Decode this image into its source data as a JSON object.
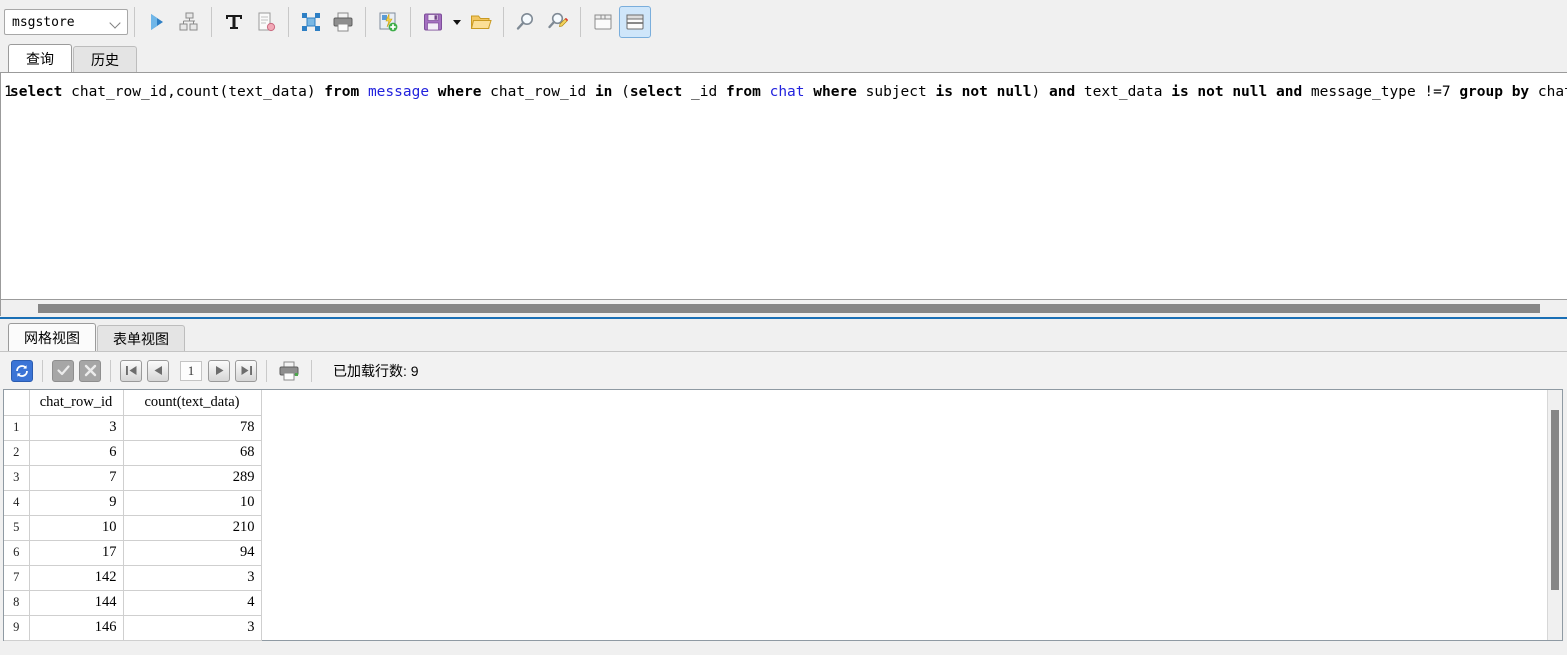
{
  "toolbar": {
    "database_select": {
      "value": "msgstore",
      "icon": "chevron-down-icon"
    },
    "buttons": [
      {
        "name": "execute-query-button",
        "icon": "play-icon",
        "title": "执行"
      },
      {
        "name": "explain-query-button",
        "icon": "hierarchy-icon",
        "title": "执行计划"
      },
      {
        "name": "format-text-button",
        "icon": "text-T-icon",
        "title": "文本"
      },
      {
        "name": "edit-script-button",
        "icon": "script-edit-icon",
        "title": "编辑脚本"
      },
      {
        "name": "expand-all-button",
        "icon": "expand-grid-icon",
        "title": "展开"
      },
      {
        "name": "print-query-button",
        "icon": "printer-icon",
        "title": "打印"
      },
      {
        "name": "export-wizard-button",
        "icon": "export-flash-icon",
        "title": "导出"
      },
      {
        "name": "save-button",
        "icon": "floppy-save-icon",
        "title": "保存"
      },
      {
        "name": "save-dropdown-button",
        "icon": "caret-down-icon",
        "title": "保存选项"
      },
      {
        "name": "open-file-button",
        "icon": "folder-open-icon",
        "title": "打开"
      },
      {
        "name": "find-button",
        "icon": "magnifier-icon",
        "title": "查找"
      },
      {
        "name": "find-replace-button",
        "icon": "magnifier-edit-icon",
        "title": "查找替换"
      },
      {
        "name": "toggle-panel-button",
        "icon": "panel-icon",
        "title": "面板"
      },
      {
        "name": "toggle-split-view-button",
        "icon": "split-view-icon",
        "title": "拆分视图",
        "active": true
      }
    ]
  },
  "top_tabs": [
    {
      "label": "查询",
      "selected": true
    },
    {
      "label": "历史",
      "selected": false
    }
  ],
  "editor": {
    "line_number": "1",
    "sql": "select chat_row_id,count(text_data) from message where chat_row_id in (select _id from chat where subject is not null) and text_data is not null and message_type !=7 group by chat_row_id;",
    "tokens": [
      {
        "t": "select",
        "k": "kw"
      },
      {
        "t": " chat_row_id,count(text_data) ",
        "k": "plain"
      },
      {
        "t": "from",
        "k": "kw"
      },
      {
        "t": " ",
        "k": "plain"
      },
      {
        "t": "message",
        "k": "tbl"
      },
      {
        "t": " ",
        "k": "plain"
      },
      {
        "t": "where",
        "k": "kw"
      },
      {
        "t": " chat_row_id ",
        "k": "plain"
      },
      {
        "t": "in",
        "k": "kw"
      },
      {
        "t": " (",
        "k": "plain"
      },
      {
        "t": "select",
        "k": "kw"
      },
      {
        "t": " _id ",
        "k": "plain"
      },
      {
        "t": "from",
        "k": "kw"
      },
      {
        "t": " ",
        "k": "plain"
      },
      {
        "t": "chat",
        "k": "tbl"
      },
      {
        "t": " ",
        "k": "plain"
      },
      {
        "t": "where",
        "k": "kw"
      },
      {
        "t": " subject ",
        "k": "plain"
      },
      {
        "t": "is not null",
        "k": "kw"
      },
      {
        "t": ") ",
        "k": "plain"
      },
      {
        "t": "and",
        "k": "kw"
      },
      {
        "t": " text_data ",
        "k": "plain"
      },
      {
        "t": "is not null",
        "k": "kw"
      },
      {
        "t": " ",
        "k": "plain"
      },
      {
        "t": "and",
        "k": "kw"
      },
      {
        "t": " message_type !=7 ",
        "k": "plain"
      },
      {
        "t": "group by",
        "k": "kw"
      },
      {
        "t": " chat_row_id;",
        "k": "plain"
      }
    ]
  },
  "bottom_tabs": [
    {
      "label": "网格视图",
      "selected": true
    },
    {
      "label": "表单视图",
      "selected": false
    }
  ],
  "result_toolbar": {
    "buttons": [
      {
        "name": "refresh-button",
        "icon": "refresh-icon",
        "state": "enabled"
      },
      {
        "name": "commit-button",
        "icon": "check-icon",
        "state": "disabled"
      },
      {
        "name": "rollback-button",
        "icon": "cross-icon",
        "state": "disabled"
      },
      {
        "name": "first-page-button",
        "icon": "arrow-first-icon",
        "state": "enabled"
      },
      {
        "name": "prev-page-button",
        "icon": "arrow-left-icon",
        "state": "enabled"
      },
      {
        "name": "next-page-button",
        "icon": "arrow-right-icon",
        "state": "enabled"
      },
      {
        "name": "last-page-button",
        "icon": "arrow-last-icon",
        "state": "enabled"
      },
      {
        "name": "print-results-button",
        "icon": "printer-icon",
        "state": "enabled"
      }
    ],
    "page_number": "1",
    "rows_loaded_label": "已加载行数: 9"
  },
  "grid": {
    "columns": [
      "chat_row_id",
      "count(text_data)"
    ],
    "rows": [
      {
        "n": "1",
        "chat_row_id": "3",
        "count": "78"
      },
      {
        "n": "2",
        "chat_row_id": "6",
        "count": "68"
      },
      {
        "n": "3",
        "chat_row_id": "7",
        "count": "289"
      },
      {
        "n": "4",
        "chat_row_id": "9",
        "count": "10"
      },
      {
        "n": "5",
        "chat_row_id": "10",
        "count": "210"
      },
      {
        "n": "6",
        "chat_row_id": "17",
        "count": "94"
      },
      {
        "n": "7",
        "chat_row_id": "142",
        "count": "3"
      },
      {
        "n": "8",
        "chat_row_id": "144",
        "count": "4"
      },
      {
        "n": "9",
        "chat_row_id": "146",
        "count": "3"
      }
    ]
  },
  "colors": {
    "accent_blue": "#1a6fb5",
    "keyword": "#000000",
    "table_name": "#2222dd",
    "active_button_bg": "#cfe6fa",
    "refresh_button_bg": "#3b74d6",
    "scrollbar_thumb": "#868686"
  }
}
